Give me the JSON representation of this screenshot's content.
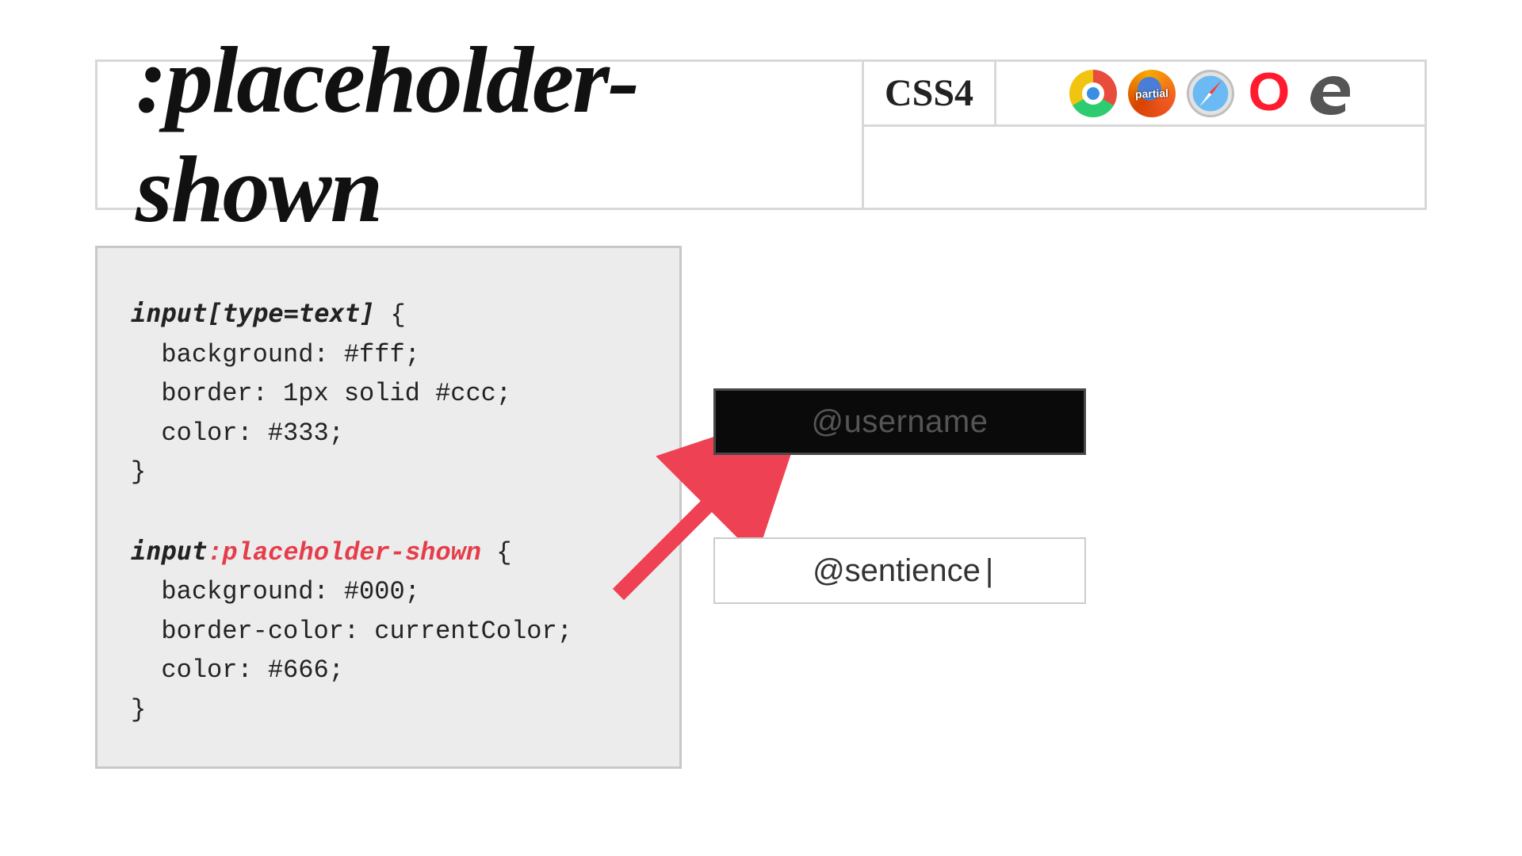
{
  "title": ":placeholder-shown",
  "spec_badge": "CSS4",
  "browsers": {
    "firefox_label": "partial"
  },
  "code": {
    "selector1": "input[type=text]",
    "brace_open": " {",
    "rule1a": "  background: #fff;",
    "rule1b": "  border: 1px solid #ccc;",
    "rule1c": "  color: #333;",
    "brace_close": "}",
    "blank": "",
    "selector2a": "input",
    "selector2b": ":placeholder-shown",
    "rule2a": "  background: #000;",
    "rule2b": "  border-color: currentColor;",
    "rule2c": "  color: #666;"
  },
  "demo": {
    "placeholder": "@username",
    "filled": "@sentience",
    "caret": "|"
  },
  "arrow_color": "#ef4154"
}
